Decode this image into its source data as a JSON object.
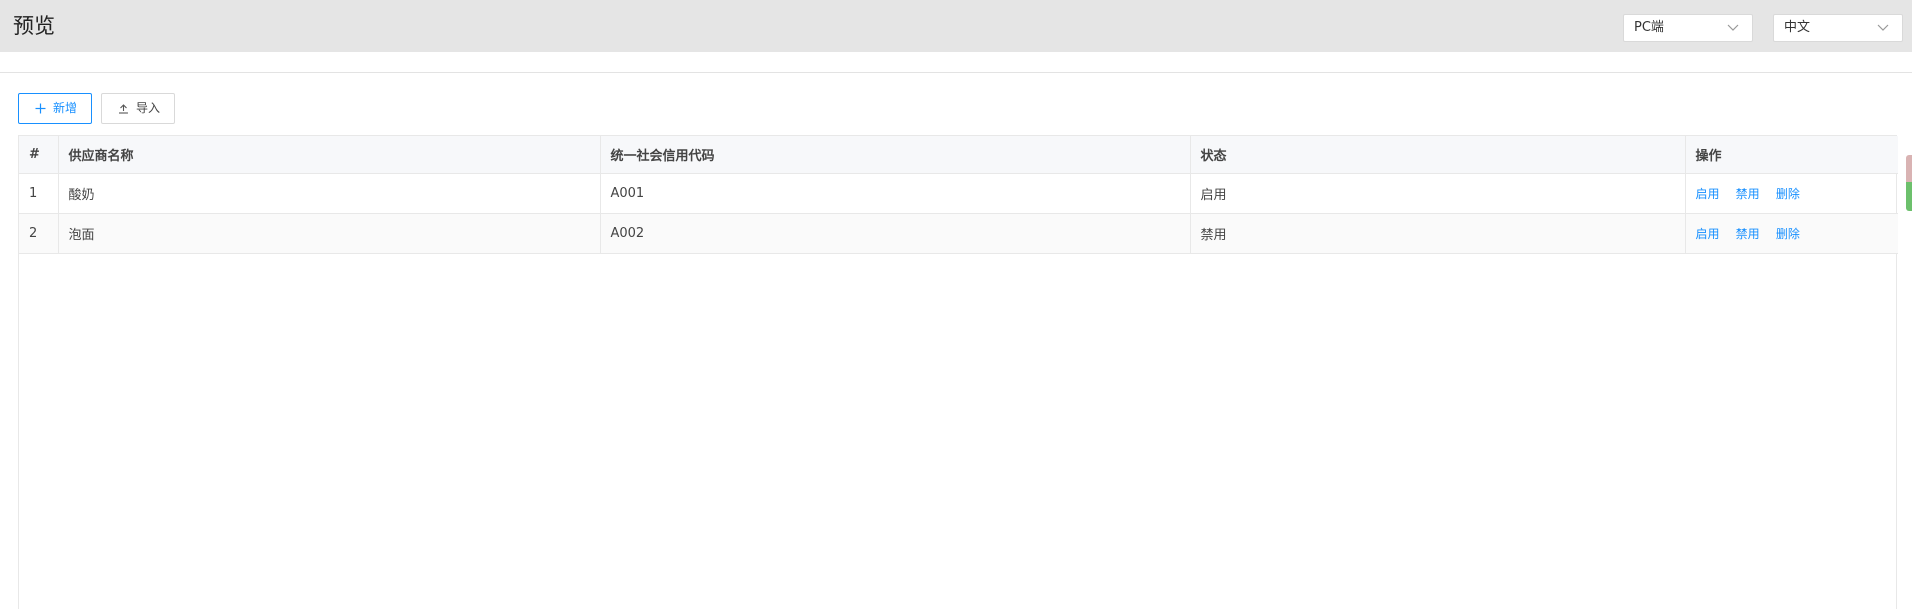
{
  "header": {
    "title": "预览",
    "platform_select": {
      "value": "PC端"
    },
    "language_select": {
      "value": "中文"
    }
  },
  "toolbar": {
    "add_label": "新增",
    "import_label": "导入"
  },
  "table": {
    "columns": [
      "#",
      "供应商名称",
      "统一社会信用代码",
      "状态",
      "操作"
    ],
    "rows": [
      {
        "index": "1",
        "name": "酸奶",
        "code": "A001",
        "status": "启用"
      },
      {
        "index": "2",
        "name": "泡面",
        "code": "A002",
        "status": "禁用"
      }
    ],
    "actions": [
      "启用",
      "禁用",
      "删除"
    ]
  },
  "colors": {
    "accent": "#1890ff",
    "header_bg": "#e5e5e5"
  }
}
